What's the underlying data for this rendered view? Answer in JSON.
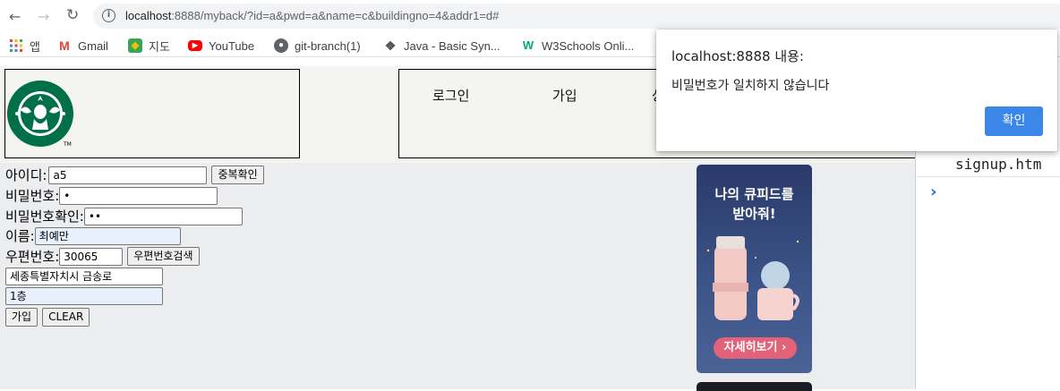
{
  "browser": {
    "url_host": "localhost",
    "url_rest": ":8888/myback/?id=a&pwd=a&name=c&buildingno=4&addr1=d#",
    "bookmarks": [
      {
        "label": "앱",
        "icon": "apps-grid-icon"
      },
      {
        "label": "Gmail",
        "icon": "gmail-icon"
      },
      {
        "label": "지도",
        "icon": "maps-icon"
      },
      {
        "label": "YouTube",
        "icon": "youtube-icon"
      },
      {
        "label": "git-branch(1)",
        "icon": "globe-icon"
      },
      {
        "label": "Java - Basic Syn...",
        "icon": "java-icon"
      },
      {
        "label": "W3Schools Onli...",
        "icon": "w3schools-icon"
      }
    ]
  },
  "header": {
    "menu": [
      "로그인",
      "가입",
      "상"
    ]
  },
  "form": {
    "id_label": "아이디:",
    "id_value": "a5",
    "dup_check_button": "중복확인",
    "pw_label": "비밀번호:",
    "pw_value": "•",
    "pw_confirm_label": "비밀번호확인:",
    "pw_confirm_value": "••",
    "name_label": "이름:",
    "name_value": "최예만",
    "zip_label": "우편번호:",
    "zip_value": "30065",
    "zip_search_button": "우편번호검색",
    "addr1_value": "세종특별자치시 금송로",
    "addr2_value": "1층",
    "submit_button": "가입",
    "clear_button": "CLEAR"
  },
  "ad": {
    "title_line1": "나의 큐피드를",
    "title_line2": "받아줘!",
    "cta": "자세히보기 ›"
  },
  "devtools": {
    "file": "signup.htm"
  },
  "dialog": {
    "title": "localhost:8888 내용:",
    "message": "비밀번호가 일치하지 않습니다",
    "ok_button": "확인"
  }
}
